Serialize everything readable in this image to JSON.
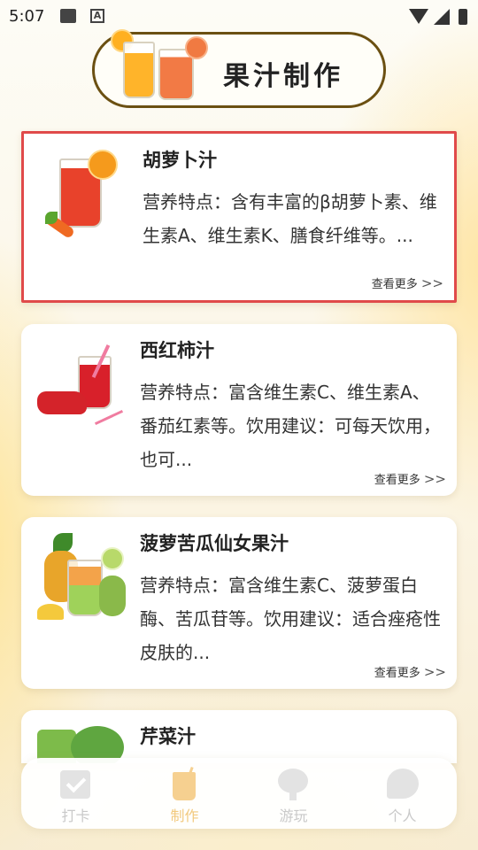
{
  "status_bar": {
    "time": "5:07"
  },
  "header": {
    "title": "果汁制作"
  },
  "cards": [
    {
      "name": "胡萝卜汁",
      "description": "营养特点：含有丰富的β胡萝卜素、维生素A、维生素K、膳食纤维等。...",
      "more": "查看更多",
      "selected": true
    },
    {
      "name": "西红柿汁",
      "description": "营养特点：富含维生素C、维生素A、番茄红素等。饮用建议：可每天饮用，也可...",
      "more": "查看更多"
    },
    {
      "name": "菠萝苦瓜仙女果汁",
      "description": "营养特点：富含维生素C、菠萝蛋白酶、苦瓜苷等。饮用建议：适合痤疮性皮肤的...",
      "more": "查看更多"
    },
    {
      "name": "芹菜汁",
      "description": "",
      "more": ""
    }
  ],
  "nav": [
    {
      "label": "打卡",
      "icon": "checkin-icon",
      "active": false
    },
    {
      "label": "制作",
      "icon": "juice-cup-icon",
      "active": true
    },
    {
      "label": "游玩",
      "icon": "tree-icon",
      "active": false
    },
    {
      "label": "个人",
      "icon": "leaf-profile-icon",
      "active": false
    }
  ],
  "colors": {
    "accent": "#f2c97e",
    "selected_border": "#e04a4a",
    "banner_border": "#6b5012"
  }
}
